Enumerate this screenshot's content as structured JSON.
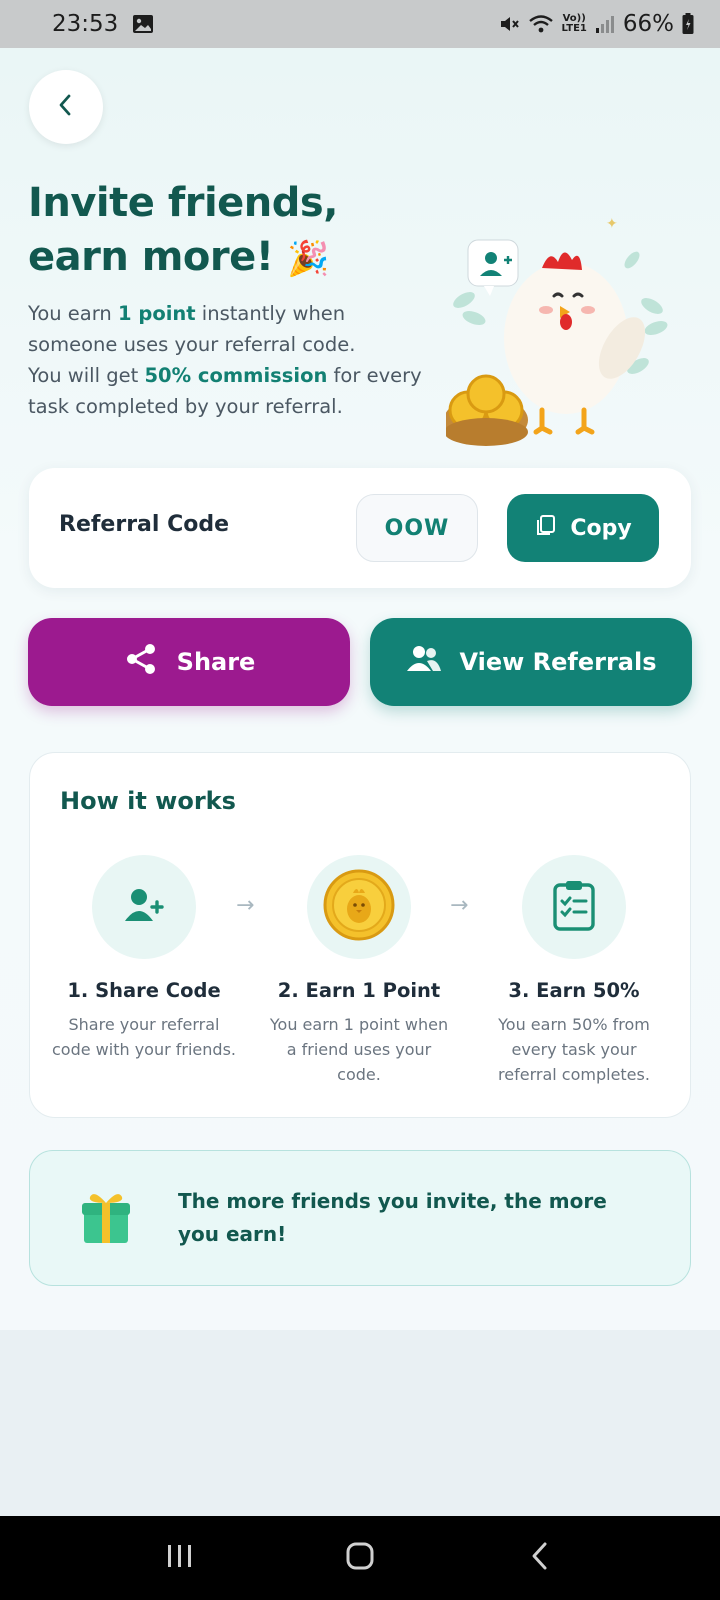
{
  "status_bar": {
    "time": "23:53",
    "battery": "66%",
    "icons": [
      "gallery-icon",
      "mute-icon",
      "wifi-icon",
      "volte-icon",
      "signal-icon",
      "battery-icon"
    ],
    "volte_label": "Vo))",
    "lte_label": "LTE1"
  },
  "header": {
    "back_icon": "chevron-left-icon",
    "title_line1": "Invite friends,",
    "title_line2": "earn more!",
    "title_emoji": "🎉"
  },
  "intro": {
    "p1_a": "You earn ",
    "p1_b": "1 point",
    "p1_c": " instantly when someone uses your referral code.",
    "p2_a": "You will get ",
    "p2_b": "50% commission",
    "p2_c": " for every task completed by your referral."
  },
  "referral": {
    "label": "Referral Code",
    "code": "OOW",
    "copy_label": "Copy"
  },
  "actions": {
    "share_label": "Share",
    "view_referrals_label": "View Referrals"
  },
  "how_it_works": {
    "title": "How it works",
    "steps": [
      {
        "title": "1. Share Code",
        "desc": "Share your referral code with your friends.",
        "icon": "add-user-icon"
      },
      {
        "title": "2. Earn 1 Point",
        "desc": "You earn 1 point when a friend uses your code.",
        "icon": "coin-icon"
      },
      {
        "title": "3. Earn 50%",
        "desc": "You earn 50% from every task your referral completes.",
        "icon": "checklist-icon"
      }
    ]
  },
  "tip": {
    "icon": "gift-icon",
    "text": "The more friends you invite, the more you earn!"
  },
  "colors": {
    "brand_teal": "#128276",
    "brand_dark": "#12584f",
    "share_purple": "#9c1a8f"
  },
  "nav": {
    "icons": [
      "recent-apps-icon",
      "home-icon",
      "back-icon"
    ]
  }
}
